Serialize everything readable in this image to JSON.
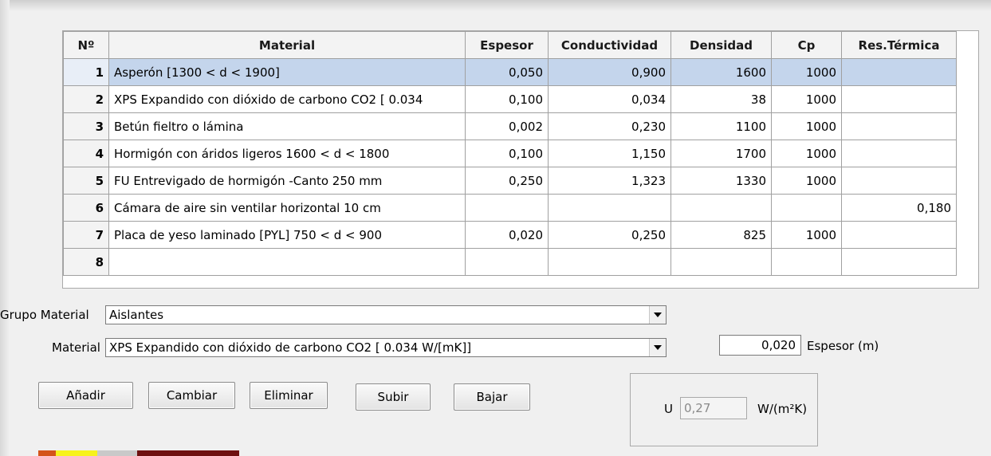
{
  "grid": {
    "headers": [
      "Nº",
      "Material",
      "Espesor",
      "Conductividad",
      "Densidad",
      "Cp",
      "Res.Térmica"
    ],
    "selected_row": 1,
    "rows": [
      {
        "n": "1",
        "material": "Asperón [1300 < d < 1900]",
        "espesor": "0,050",
        "conductividad": "0,900",
        "densidad": "1600",
        "cp": "1000",
        "res": ""
      },
      {
        "n": "2",
        "material": "XPS Expandido con dióxido de carbono CO2 [ 0.034",
        "espesor": "0,100",
        "conductividad": "0,034",
        "densidad": "38",
        "cp": "1000",
        "res": ""
      },
      {
        "n": "3",
        "material": "Betún fieltro o lámina",
        "espesor": "0,002",
        "conductividad": "0,230",
        "densidad": "1100",
        "cp": "1000",
        "res": ""
      },
      {
        "n": "4",
        "material": "Hormigón con áridos ligeros 1600 < d < 1800",
        "espesor": "0,100",
        "conductividad": "1,150",
        "densidad": "1700",
        "cp": "1000",
        "res": ""
      },
      {
        "n": "5",
        "material": "FU Entrevigado de hormigón -Canto 250 mm",
        "espesor": "0,250",
        "conductividad": "1,323",
        "densidad": "1330",
        "cp": "1000",
        "res": ""
      },
      {
        "n": "6",
        "material": "Cámara de aire sin ventilar horizontal 10 cm",
        "espesor": "",
        "conductividad": "",
        "densidad": "",
        "cp": "",
        "res": "0,180"
      },
      {
        "n": "7",
        "material": "Placa de yeso laminado [PYL] 750 < d < 900",
        "espesor": "0,020",
        "conductividad": "0,250",
        "densidad": "825",
        "cp": "1000",
        "res": ""
      },
      {
        "n": "8",
        "material": "",
        "espesor": "",
        "conductividad": "",
        "densidad": "",
        "cp": "",
        "res": ""
      }
    ]
  },
  "form": {
    "grupo_label": "Grupo Material",
    "grupo_value": "Aislantes",
    "material_label": "Material",
    "material_value": "XPS Expandido con dióxido de carbono CO2 [ 0.034 W/[mK]]",
    "espesor_value": "0,020",
    "espesor_label": "Espesor (m)"
  },
  "buttons": {
    "anadir": "Añadir",
    "cambiar": "Cambiar",
    "eliminar": "Eliminar",
    "subir": "Subir",
    "bajar": "Bajar"
  },
  "u_panel": {
    "label": "U",
    "value": "0,27",
    "unit": "W/(m²K)"
  },
  "colors": {
    "selection": "#c4d5ec",
    "swatches": [
      "#d4541a",
      "#f7f21c",
      "#c9c9c9",
      "#6e1010"
    ]
  }
}
